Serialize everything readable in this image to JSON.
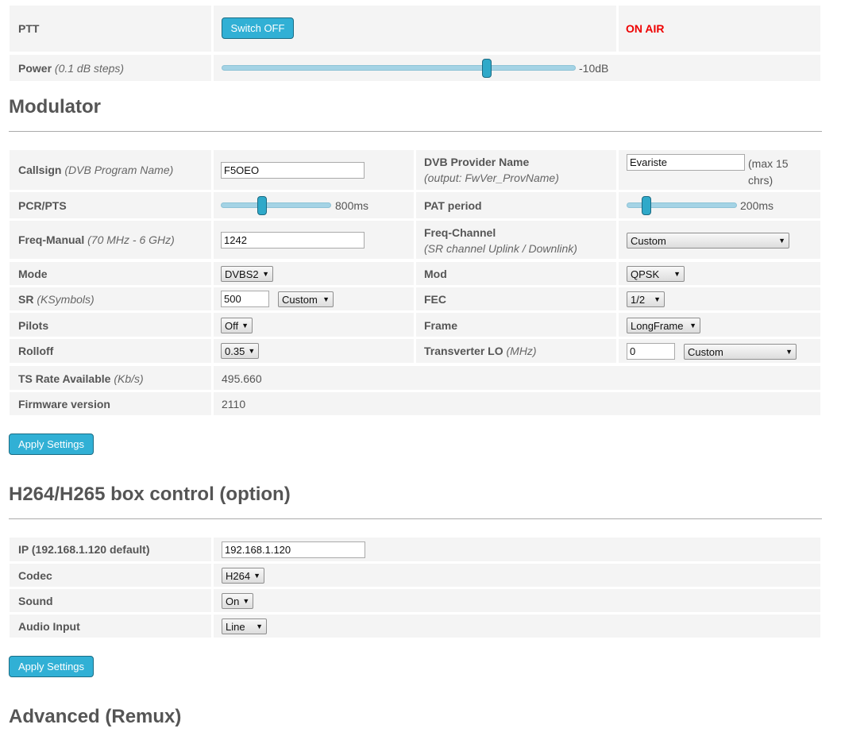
{
  "ptt": {
    "label": "PTT",
    "button": "Switch OFF",
    "status": "ON AIR"
  },
  "power": {
    "label": "Power",
    "sub": "(0.1 dB steps)",
    "value_text": "-10dB",
    "level": 0.76
  },
  "modulator": {
    "title": "Modulator",
    "callsign": {
      "label": "Callsign",
      "sub": "(DVB Program Name)",
      "value": "F5OEO"
    },
    "provider": {
      "label": "DVB Provider Name",
      "sub": "(output: FwVer_ProvName)",
      "value": "Evariste",
      "note": "(max 15 chrs)"
    },
    "pcr": {
      "label": "PCR/PTS",
      "value_text": "800ms",
      "level": 0.37
    },
    "pat": {
      "label": "PAT period",
      "value_text": "200ms",
      "level": 0.15
    },
    "freq_manual": {
      "label": "Freq-Manual",
      "sub": "(70 MHz - 6 GHz)",
      "value": "1242"
    },
    "freq_channel": {
      "label": "Freq-Channel",
      "sub": "(SR channel Uplink / Downlink)",
      "selected": "Custom"
    },
    "mode": {
      "label": "Mode",
      "selected": "DVBS2"
    },
    "mod": {
      "label": "Mod",
      "selected": "QPSK"
    },
    "sr": {
      "label": "SR",
      "sub": "(KSymbols)",
      "value": "500",
      "selected": "Custom"
    },
    "fec": {
      "label": "FEC",
      "selected": "1/2"
    },
    "pilots": {
      "label": "Pilots",
      "selected": "Off"
    },
    "frame": {
      "label": "Frame",
      "selected": "LongFrame"
    },
    "rolloff": {
      "label": "Rolloff",
      "selected": "0.35"
    },
    "transverter": {
      "label": "Transverter LO",
      "sub": "(MHz)",
      "value": "0",
      "selected": "Custom"
    },
    "ts_rate": {
      "label": "TS Rate Available",
      "sub": "(Kb/s)",
      "value": "495.660"
    },
    "firmware": {
      "label": "Firmware version",
      "value": "2110"
    },
    "apply": "Apply Settings"
  },
  "h264": {
    "title": "H264/H265 box control (option)",
    "ip": {
      "label": "IP (192.168.1.120 default)",
      "value": "192.168.1.120"
    },
    "codec": {
      "label": "Codec",
      "selected": "H264"
    },
    "sound": {
      "label": "Sound",
      "selected": "On"
    },
    "audio_input": {
      "label": "Audio Input",
      "selected": "Line"
    },
    "apply": "Apply Settings"
  },
  "advanced": {
    "title": "Advanced (Remux)"
  },
  "colors": {
    "button": "#31b0d5",
    "onair": "#ee0000",
    "cell": "#f4f4f4",
    "slider_thumb": "#2fa9c9"
  },
  "icons": {
    "dropdown": "triangle-down-icon"
  }
}
